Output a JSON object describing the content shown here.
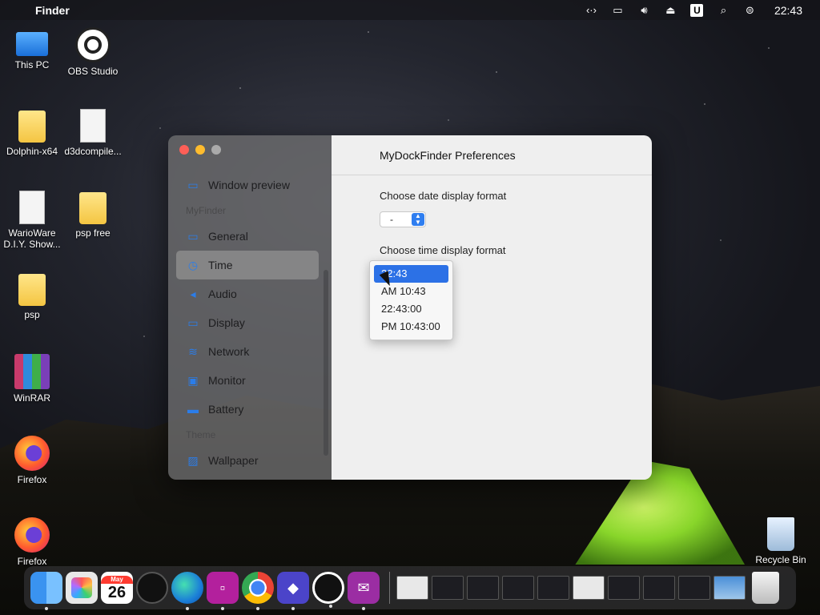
{
  "menubar": {
    "app_name": "Finder",
    "clock": "22:43",
    "apple_icon": "apple-icon",
    "status_icons": [
      "code-arrows-icon",
      "display-icon",
      "volume-icon",
      "eject-icon",
      "u-icon",
      "search-icon",
      "control-center-icon"
    ]
  },
  "desktop_icons": [
    {
      "label": "This PC"
    },
    {
      "label": "OBS Studio"
    },
    {
      "label": "Dolphin-x64"
    },
    {
      "label": "d3dcompile..."
    },
    {
      "label": "WarioWare D.I.Y. Show..."
    },
    {
      "label": "psp free"
    },
    {
      "label": "psp"
    },
    {
      "label": "WinRAR"
    },
    {
      "label": "Firefox"
    },
    {
      "label": "Firefox"
    },
    {
      "label": "Recycle Bin"
    }
  ],
  "window": {
    "title": "MyDockFinder Preferences",
    "sidebar": {
      "items": [
        {
          "label": "Window preview",
          "icon": "window-preview-icon"
        },
        {
          "section": "MyFinder"
        },
        {
          "label": "General",
          "icon": "general-icon"
        },
        {
          "label": "Time",
          "icon": "clock-icon",
          "selected": true
        },
        {
          "label": "Audio",
          "icon": "speaker-icon"
        },
        {
          "label": "Display",
          "icon": "display-icon"
        },
        {
          "label": "Network",
          "icon": "wifi-icon"
        },
        {
          "label": "Monitor",
          "icon": "cpu-icon"
        },
        {
          "label": "Battery",
          "icon": "battery-icon"
        },
        {
          "section": "Theme"
        },
        {
          "label": "Wallpaper",
          "icon": "wallpaper-icon"
        }
      ]
    },
    "date_format": {
      "label": "Choose date display format",
      "value": "-"
    },
    "time_format": {
      "label": "Choose time display format",
      "options": [
        "22:43",
        "AM 10:43",
        "22:43:00",
        "PM 10:43:00"
      ],
      "selected_index": 0
    }
  },
  "colors": {
    "accent": "#2c71e6",
    "close": "#fe5f57",
    "minimize": "#febc2e"
  },
  "dock": {
    "calendar_month": "May",
    "calendar_day": "26"
  }
}
